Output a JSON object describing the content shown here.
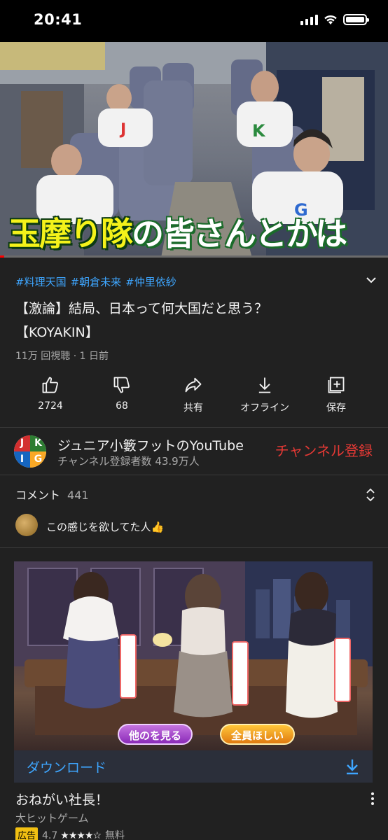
{
  "status_bar": {
    "time": "20:41",
    "icons": [
      "cellular-signal-icon",
      "wifi-icon",
      "battery-icon"
    ]
  },
  "video": {
    "caption_part1": "玉摩り隊",
    "caption_part2": "の皆さんとかは",
    "progress_fraction": 0.01
  },
  "details": {
    "hashtags": [
      "#料理天国",
      "#朝倉未来",
      "#仲里依紗"
    ],
    "title_line1": "【激論】結局、日本って何大国だと思う？",
    "title_line2": "【KOYAKIN】",
    "meta": "11万 回視聴 · 1 日前"
  },
  "actions": [
    {
      "id": "like",
      "icon": "thumbs-up-icon",
      "label": "2724"
    },
    {
      "id": "dislike",
      "icon": "thumbs-down-icon",
      "label": "68"
    },
    {
      "id": "share",
      "icon": "share-icon",
      "label": "共有"
    },
    {
      "id": "offline",
      "icon": "download-icon",
      "label": "オフライン"
    },
    {
      "id": "save",
      "icon": "add-to-playlist-icon",
      "label": "保存"
    }
  ],
  "channel": {
    "avatar_letters": [
      "J",
      "K",
      "I",
      "G"
    ],
    "name": "ジュニア小籔フットのYouTube",
    "subscribers": "チャンネル登録者数 43.9万人",
    "subscribe_label": "チャンネル登録"
  },
  "comments": {
    "header": "コメント",
    "count": "441",
    "top_comment": "この感じを欲してた人👍"
  },
  "ad": {
    "button_left": "他のを見る",
    "button_right": "全員ほしい",
    "download_label": "ダウンロード",
    "title": "おねがい社長！",
    "subtitle": "大ヒットゲーム",
    "badge": "広告",
    "rating": "4.7",
    "stars": "★★★★☆",
    "price": "無料"
  },
  "colors": {
    "background": "#212121",
    "link_blue": "#3ea6ff",
    "subscribe_red": "#e53935",
    "progress_red": "#ff0000",
    "ad_badge_yellow": "#f2c012"
  }
}
